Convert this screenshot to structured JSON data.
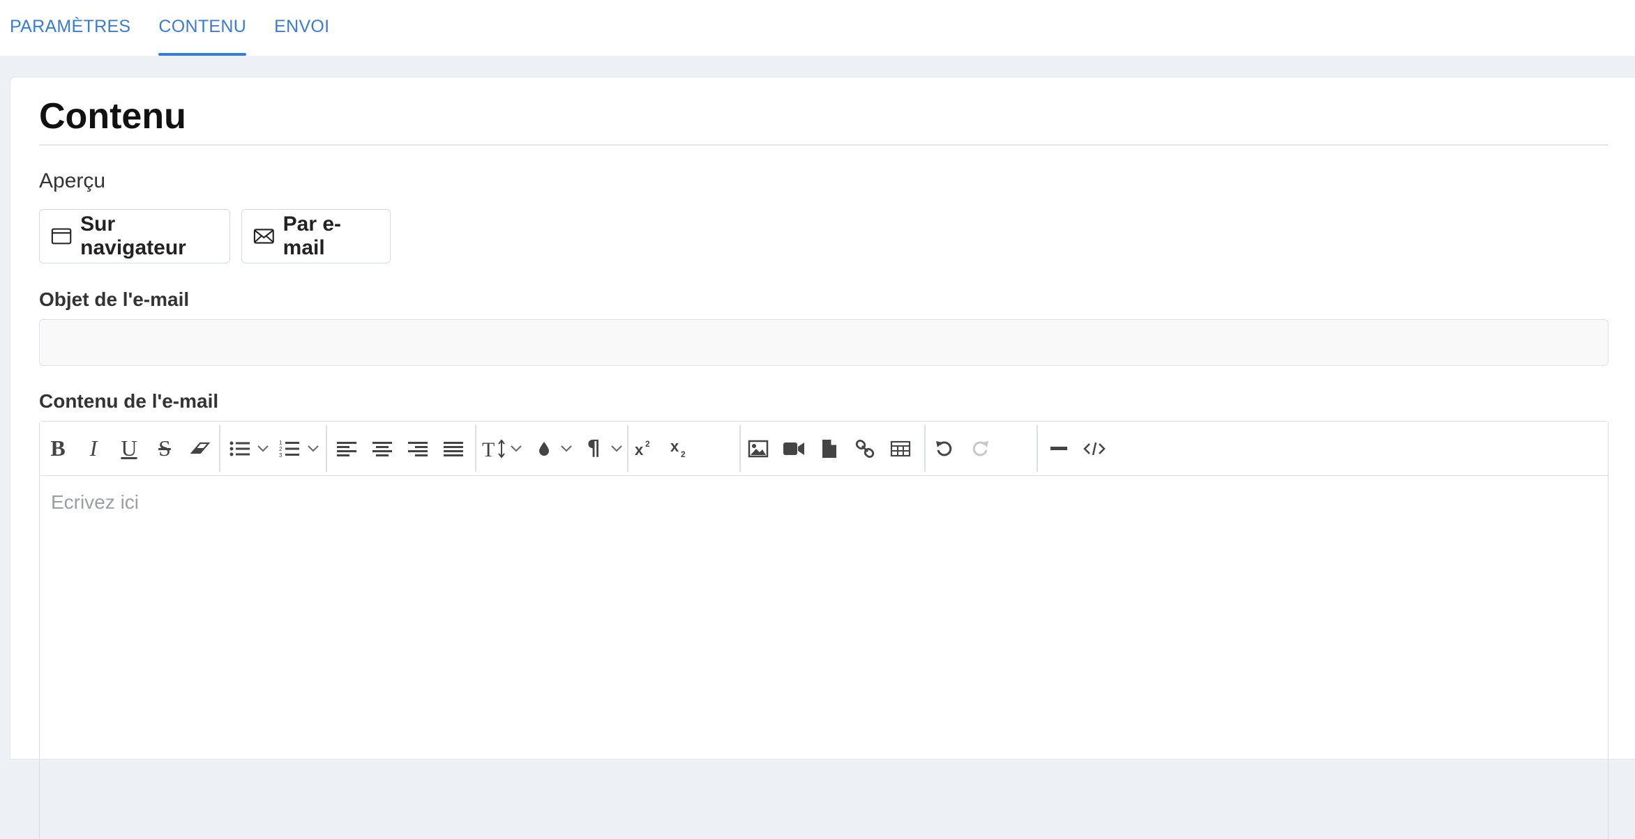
{
  "tabs": [
    {
      "label": "PARAMÈTRES",
      "active": false
    },
    {
      "label": "CONTENU",
      "active": true
    },
    {
      "label": "ENVOI",
      "active": false
    }
  ],
  "page": {
    "title": "Contenu",
    "preview_label": "Aperçu",
    "preview_browser_button": "Sur navigateur",
    "preview_email_button": "Par e-mail"
  },
  "subject": {
    "label": "Objet de l'e-mail",
    "value": "",
    "placeholder": ""
  },
  "content": {
    "label": "Contenu de l'e-mail",
    "placeholder": "Ecrivez ici"
  },
  "toolbar": {
    "icons": [
      "bold-icon",
      "italic-icon",
      "underline-icon",
      "strikethrough-icon",
      "eraser-icon",
      "bullet-list-icon",
      "numbered-list-icon",
      "align-left-icon",
      "align-center-icon",
      "align-right-icon",
      "align-justify-icon",
      "font-size-icon",
      "text-color-icon",
      "paragraph-icon",
      "superscript-icon",
      "subscript-icon",
      "image-icon",
      "video-icon",
      "file-icon",
      "link-icon",
      "table-icon",
      "undo-icon",
      "redo-icon",
      "horizontal-rule-icon",
      "code-view-icon"
    ],
    "disabled": [
      "redo-icon"
    ]
  },
  "colors": {
    "accent": "#3a7bd5",
    "background": "#edf0f5",
    "icon": "#444444",
    "icon_disabled": "#c4c7cc"
  }
}
